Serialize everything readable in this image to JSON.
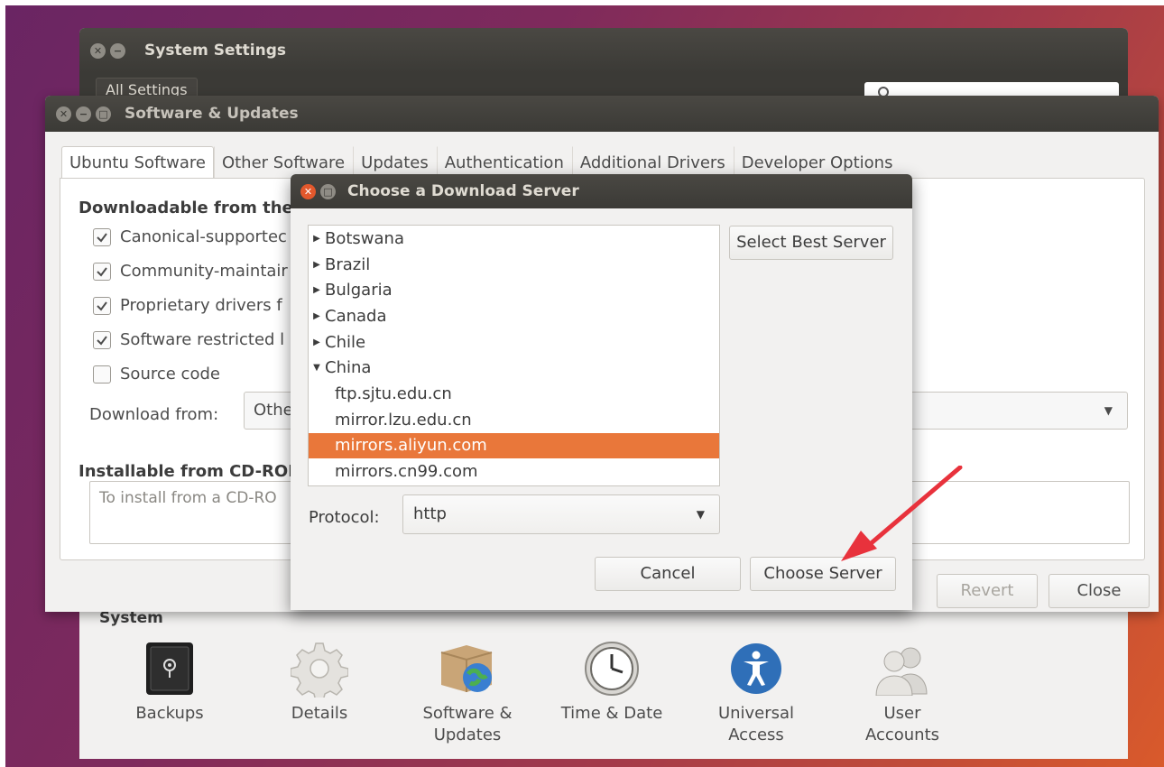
{
  "system_settings": {
    "title": "System Settings",
    "all_settings_label": "All Settings",
    "section_title": "System",
    "items": [
      {
        "label": "Backups",
        "icon": "safe-icon"
      },
      {
        "label": "Details",
        "icon": "gear-icon"
      },
      {
        "label": "Software &\nUpdates",
        "icon": "software-box-globe-icon"
      },
      {
        "label": "Time & Date",
        "icon": "clock-icon"
      },
      {
        "label": "Universal\nAccess",
        "icon": "accessibility-icon"
      },
      {
        "label": "User\nAccounts",
        "icon": "users-icon"
      }
    ]
  },
  "software_updates": {
    "title": "Software & Updates",
    "tabs": [
      "Ubuntu Software",
      "Other Software",
      "Updates",
      "Authentication",
      "Additional Drivers",
      "Developer Options"
    ],
    "active_tab": "Ubuntu Software",
    "downloadable_heading": "Downloadable from the",
    "checkboxes": [
      {
        "label": "Canonical-supportec",
        "checked": true
      },
      {
        "label": "Community-maintair",
        "checked": true
      },
      {
        "label": "Proprietary drivers f",
        "checked": true
      },
      {
        "label": "Software restricted l",
        "checked": true
      },
      {
        "label": "Source code",
        "checked": false
      }
    ],
    "download_from_label": "Download from:",
    "download_from_value": "Othe",
    "installable_heading": "Installable from CD-ROM",
    "cdrom_text": "To install from a CD-RO",
    "revert_label": "Revert",
    "close_label": "Close"
  },
  "dialog": {
    "title": "Choose a Download Server",
    "servers": [
      {
        "label": "Botswana",
        "type": "country",
        "expanded": false
      },
      {
        "label": "Brazil",
        "type": "country",
        "expanded": false
      },
      {
        "label": "Bulgaria",
        "type": "country",
        "expanded": false
      },
      {
        "label": "Canada",
        "type": "country",
        "expanded": false
      },
      {
        "label": "Chile",
        "type": "country",
        "expanded": false
      },
      {
        "label": "China",
        "type": "country",
        "expanded": true
      },
      {
        "label": "ftp.sjtu.edu.cn",
        "type": "mirror"
      },
      {
        "label": "mirror.lzu.edu.cn",
        "type": "mirror"
      },
      {
        "label": "mirrors.aliyun.com",
        "type": "mirror",
        "selected": true
      },
      {
        "label": "mirrors.cn99.com",
        "type": "mirror"
      }
    ],
    "select_best_label": "Select Best Server",
    "protocol_label": "Protocol:",
    "protocol_value": "http",
    "cancel_label": "Cancel",
    "choose_label": "Choose Server"
  },
  "colors": {
    "selection": "#e9773a",
    "close_button": "#e3582c",
    "titlebar": "#3b3a36",
    "annotation_arrow": "#e8323c"
  }
}
